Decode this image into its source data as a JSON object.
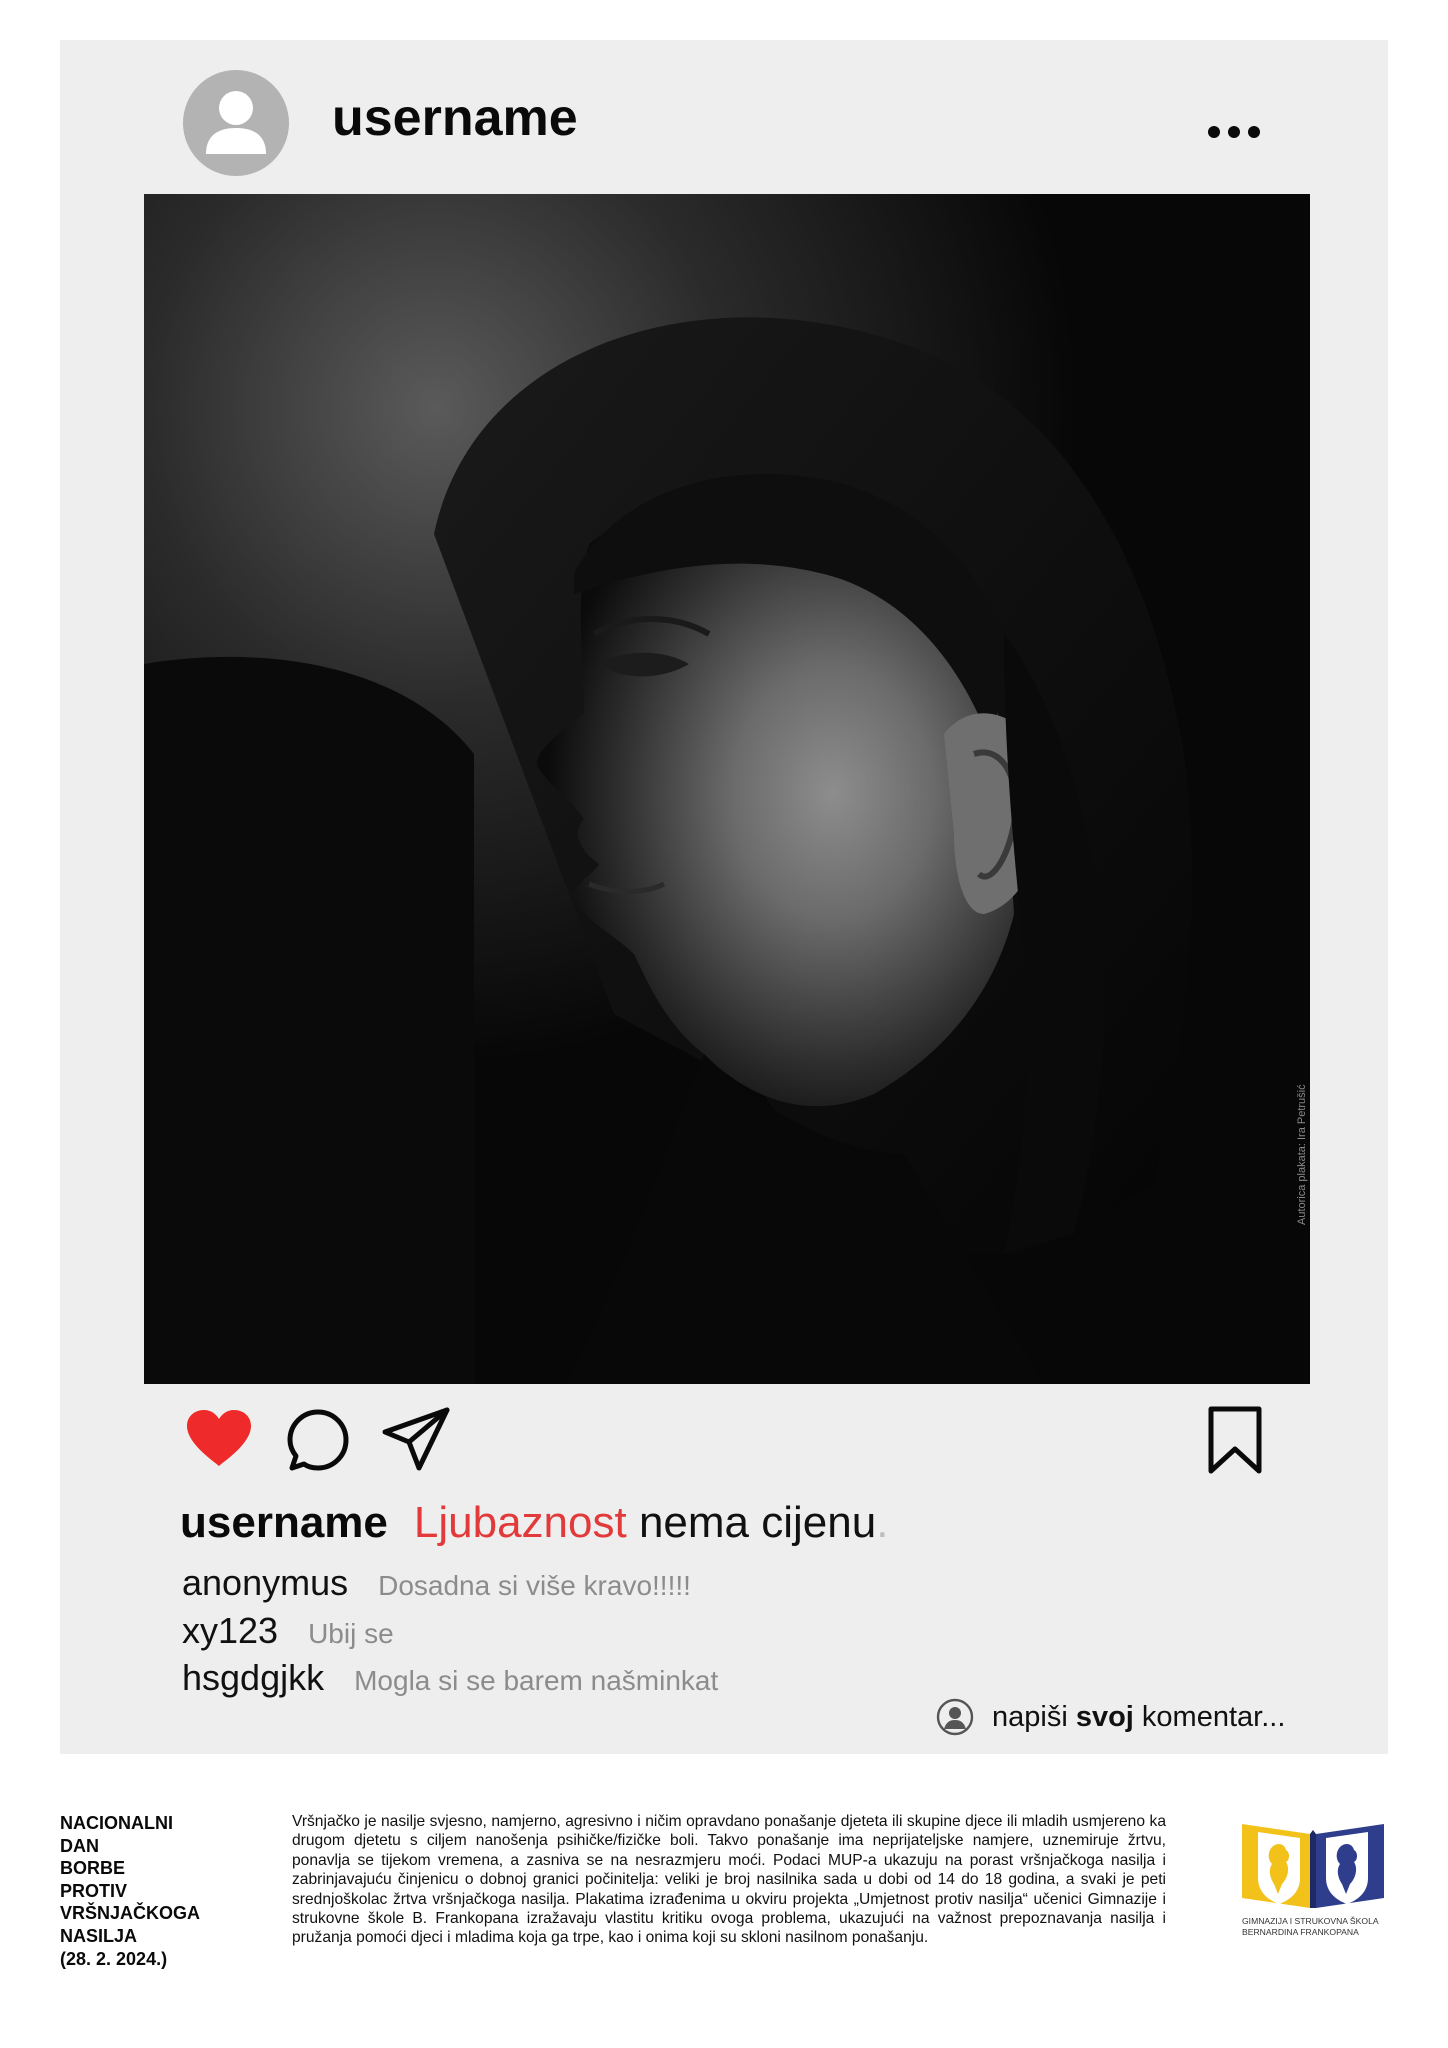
{
  "post": {
    "header_username": "username",
    "avatar_icon": "user-avatar-icon",
    "more_icon": "more-options-icon",
    "photo_credit": "Autorica plakata: Ira Petrušić",
    "actions": {
      "like_icon": "heart-icon",
      "comment_icon": "comment-bubble-icon",
      "share_icon": "send-icon",
      "save_icon": "bookmark-icon",
      "like_color": "#ee2a2a"
    },
    "caption": {
      "username": "username",
      "highlight": "Ljubaznost",
      "rest": " nema cijenu",
      "dot": ".",
      "highlight_color": "#e23a3a"
    },
    "comments": [
      {
        "user": "anonymus",
        "text": "Dosadna si više kravo!!!!!"
      },
      {
        "user": "xy123",
        "text": "Ubij se"
      },
      {
        "user": "hsgdgjkk",
        "text": "Mogla si se barem našminkat"
      }
    ],
    "write_comment": {
      "icon": "user-circle-icon",
      "prefix": "napiši ",
      "bold": "svoj",
      "suffix": " komentar..."
    }
  },
  "footer": {
    "title_lines": [
      "NACIONALNI",
      "DAN",
      "BORBE",
      "PROTIV",
      "VRŠNJAČKOGA",
      "NASILJA",
      "(28. 2. 2024.)"
    ],
    "body": "Vršnjačko je nasilje svjesno, namjerno, agresivno i ničim opravdano ponašanje djeteta ili skupine djece ili mladih usmjereno ka drugom djetetu s ciljem nanošenja psihičke/fizičke boli. Takvo ponašanje ima neprijateljske namjere, uznemiruje žrtvu, ponavlja se tijekom vremena, a zasniva se na nesrazmjeru moći. Podaci MUP-a ukazuju na porast vršnjačkoga nasilja i zabrinjavajuću činjenicu o dobnoj granici počinitelja: veliki je broj nasilnika sada u dobi od 14 do 18 godina, a svaki je peti srednjoškolac žrtva vršnjačkoga nasilja. Plakatima izrađenima u okviru projekta „Umjetnost protiv nasilja“ učenici Gimnazije i strukovne škole B. Frankopana izražavaju vlastitu kritiku ovoga problema, ukazujući na važnost prepoznavanja nasilja i pružanja pomoći djeci i mladima koja ga trpe, kao i onima koji su skloni nasilnom ponašanju.",
    "logo": {
      "line1": "GIMNAZIJA I STRUKOVNA ŠKOLA",
      "line2": "BERNARDINA FRANKOPANA",
      "colors": {
        "yellow": "#f2c21b",
        "blue": "#2e3e8c"
      }
    }
  }
}
